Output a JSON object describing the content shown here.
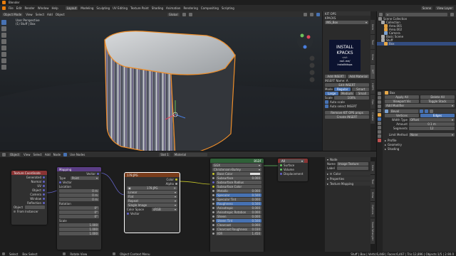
{
  "app": {
    "title": "Blender"
  },
  "menu": [
    "File",
    "Edit",
    "Render",
    "Window",
    "Help"
  ],
  "workspaces": [
    "Layout",
    "Modeling",
    "Sculpting",
    "UV Editing",
    "Texture Paint",
    "Shading",
    "Animation",
    "Rendering",
    "Compositing",
    "Scripting"
  ],
  "scene": {
    "name": "Scene",
    "view_layer": "View Layer"
  },
  "viewport": {
    "header": [
      "Object Mode",
      "View",
      "Select",
      "Add",
      "Object"
    ],
    "transform": "Global",
    "info_line1": "User Perspective",
    "info_line2": "(1) Stuff | Box"
  },
  "addon": {
    "title": "KIT OPS",
    "kpacks_label": "KPACKS",
    "pack": "INS_Box",
    "thumb_lines": [
      "INSTALL",
      "KPACKS",
      "visit",
      "cw1.me/",
      "installkitops"
    ],
    "add_insert": "Add INSERT",
    "add_material": "Add Material",
    "insert_name": "INSERT Name: A",
    "edit_insert": "Edit INSERT",
    "mode_label": "Mode",
    "modes": [
      "Regular",
      "Smart"
    ],
    "sizes": [
      "Large",
      "Medium",
      "Small"
    ],
    "scale_label": "Scale",
    "scale_value": "100%",
    "auto_scale": "Auto scale",
    "auto_select": "Auto select INSERT",
    "remove_kitops": "Remove KIT OPS props",
    "create_insert": "Create INSERT",
    "vtabs": [
      "Item",
      "Tool",
      "View",
      "KIT",
      "HOPS",
      "Ops",
      "Create"
    ]
  },
  "outliner": {
    "rows": [
      "Scene Collection",
      "Collection",
      "Area.001",
      "Area.002",
      "Camera",
      "Basic Scene",
      "Stuff",
      "Box"
    ]
  },
  "properties": {
    "object": "Box",
    "add_modifier": "Add Modifier",
    "modifier": "Bevel",
    "apply": "Apply All",
    "delete": "Delete All",
    "viewport_vis": "Viewport Vis",
    "toggle_stack": "Toggle Stack",
    "vertices": "Vertices",
    "edges": "Edges",
    "width_type_label": "Width Type",
    "width_type": "Offset",
    "amount_label": "Amount",
    "amount": "0.1 m",
    "segments_label": "Segments",
    "segments": "12",
    "limit_label": "Limit Method",
    "limit": "None",
    "sections": [
      "Profile",
      "Geometry",
      "Shading"
    ]
  },
  "node_editor": {
    "header": [
      "Object",
      "View",
      "Select",
      "Add",
      "Node"
    ],
    "use_nodes": "Use Nodes",
    "slot": "Slot 1",
    "material": "Material",
    "nodes": {
      "texcoord": {
        "title": "Texture Coordinate",
        "outputs": [
          "Generated",
          "Normal",
          "UV",
          "Object",
          "Camera",
          "Window",
          "Reflection"
        ],
        "object_label": "Object",
        "from_instancer": "From Instancer"
      },
      "mapping": {
        "title": "Mapping",
        "vector": "Vector",
        "type_label": "Type",
        "type": "Point",
        "vector_in": "Vector",
        "location": "Location",
        "rotation": "Rotation",
        "scale": "Scale",
        "loc": [
          "0 m",
          "0 m",
          "0 m"
        ],
        "rot": [
          "0°",
          "0°",
          "0°"
        ],
        "scl": [
          "1.000",
          "1.000",
          "1.000"
        ]
      },
      "image": {
        "title": "178.JPG",
        "outputs": [
          "Color",
          "Alpha"
        ],
        "file": "178.JPG",
        "settings": [
          "Linear",
          "Flat",
          "Repeat",
          "Single Image"
        ],
        "color_space_label": "Color Space",
        "color_space": "sRGB",
        "vector": "Vector"
      },
      "bsdf": {
        "title": "BSDF",
        "dist": "GGX",
        "sss": "Christensen-Burley",
        "rows": [
          [
            "Base Color",
            ""
          ],
          [
            "Subsurface",
            "0.000"
          ],
          [
            "Subsurface Radius",
            ""
          ],
          [
            "Subsurface Color",
            ""
          ],
          [
            "Metallic",
            "0.000"
          ],
          [
            "Specular",
            "0.500"
          ],
          [
            "Specular Tint",
            "0.000"
          ],
          [
            "Roughness",
            "0.500"
          ],
          [
            "Anisotropic",
            "0.000"
          ],
          [
            "Anisotropic Rotation",
            "0.000"
          ],
          [
            "Sheen",
            "0.000"
          ],
          [
            "Sheen Tint",
            "0.500"
          ],
          [
            "Clearcoat",
            "0.000"
          ],
          [
            "Clearcoat Roughness",
            "0.030"
          ],
          [
            "IOR",
            "1.450"
          ]
        ]
      },
      "output": {
        "title": "All",
        "inputs": [
          "Surface",
          "Volume",
          "Displacement"
        ]
      }
    },
    "sidebar": {
      "node_label": "Node",
      "name_label": "Name",
      "name": "Image Texture",
      "label_label": "Label",
      "color": "Color",
      "properties": "Properties",
      "mapping": "Texture Mapping"
    },
    "vtabs": [
      "Item",
      "Tool",
      "View",
      "Options",
      "Node Wrangler"
    ]
  },
  "status": {
    "select": "Select",
    "box_select": "Box Select",
    "rotate_view": "Rotate View",
    "context_menu": "Object Context Menu",
    "stats": "Stuff | Box | Verts:6,448 | Faces:6,467 | Tris:12,896 | Objects:1/5 | 2.90.0"
  },
  "colors": {
    "accent": "#4772b3",
    "image_header": "#7a3d1c",
    "shader_header": "#2f6138",
    "input_header": "#8a3434",
    "vector_header": "#5b3d85",
    "selection_outline": "#ee8e2a"
  }
}
